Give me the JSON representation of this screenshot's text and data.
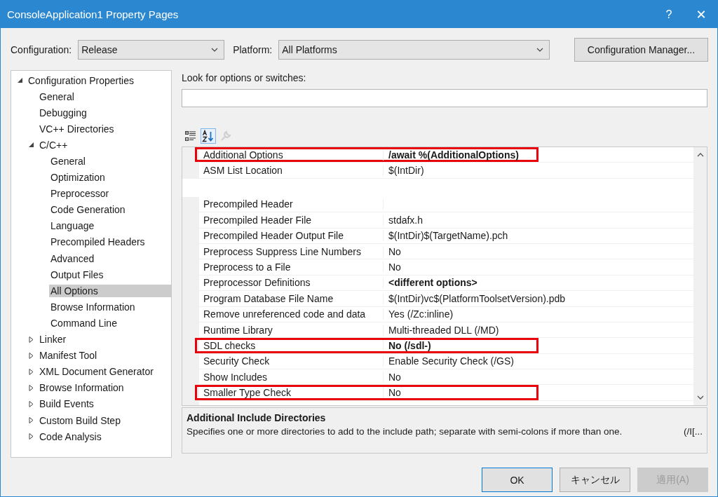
{
  "window": {
    "title": "ConsoleApplication1 Property Pages",
    "help": "?",
    "close": "✕"
  },
  "configuration": {
    "label": "Configuration:",
    "value": "Release"
  },
  "platform": {
    "label": "Platform:",
    "value": "All Platforms"
  },
  "configuration_manager": "Configuration Manager...",
  "tree": [
    {
      "label": "Configuration Properties",
      "expanded": true,
      "selected": false,
      "children": [
        {
          "label": "General",
          "selected": false
        },
        {
          "label": "Debugging",
          "selected": false
        },
        {
          "label": "VC++ Directories",
          "selected": false
        },
        {
          "label": "C/C++",
          "expanded": true,
          "selected": false,
          "children": [
            {
              "label": "General",
              "selected": false
            },
            {
              "label": "Optimization",
              "selected": false
            },
            {
              "label": "Preprocessor",
              "selected": false
            },
            {
              "label": "Code Generation",
              "selected": false
            },
            {
              "label": "Language",
              "selected": false
            },
            {
              "label": "Precompiled Headers",
              "selected": false
            },
            {
              "label": "Advanced",
              "selected": false
            },
            {
              "label": "Output Files",
              "selected": false
            },
            {
              "label": "All Options",
              "selected": true
            },
            {
              "label": "Browse Information",
              "selected": false
            },
            {
              "label": "Command Line",
              "selected": false
            }
          ]
        },
        {
          "label": "Linker",
          "expanded": false,
          "selected": false
        },
        {
          "label": "Manifest Tool",
          "expanded": false,
          "selected": false
        },
        {
          "label": "XML Document Generator",
          "expanded": false,
          "selected": false
        },
        {
          "label": "Browse Information",
          "expanded": false,
          "selected": false
        },
        {
          "label": "Build Events",
          "expanded": false,
          "selected": false
        },
        {
          "label": "Custom Build Step",
          "expanded": false,
          "selected": false
        },
        {
          "label": "Code Analysis",
          "expanded": false,
          "selected": false
        }
      ]
    }
  ],
  "search": {
    "label": "Look for options or switches:"
  },
  "toolbar": [
    {
      "kind": "categorized",
      "selected": false,
      "disabled": false
    },
    {
      "kind": "alphabetical",
      "selected": true,
      "disabled": false
    },
    {
      "kind": "property-pages",
      "selected": false,
      "disabled": true
    }
  ],
  "properties": [
    {
      "kind": "row",
      "name": "Additional Options",
      "value": "/await %(AdditionalOptions)",
      "bold": true,
      "highlighted": true
    },
    {
      "kind": "row",
      "name": "ASM List Location",
      "value": "$(IntDir)",
      "bold": false,
      "highlighted": false
    },
    {
      "kind": "covered"
    },
    {
      "kind": "row",
      "name": "Precompiled Header",
      "highlighted": false
    },
    {
      "kind": "row",
      "name": "Precompiled Header File",
      "value": "stdafx.h",
      "bold": false,
      "highlighted": false
    },
    {
      "kind": "row",
      "name": "Precompiled Header Output File",
      "value": "$(IntDir)$(TargetName).pch",
      "bold": false,
      "highlighted": false
    },
    {
      "kind": "row",
      "name": "Preprocess Suppress Line Numbers",
      "value": "No",
      "bold": false,
      "highlighted": false
    },
    {
      "kind": "row",
      "name": "Preprocess to a File",
      "value": "No",
      "bold": false,
      "highlighted": false
    },
    {
      "kind": "row",
      "name": "Preprocessor Definitions",
      "value": "<different options>",
      "bold": true,
      "highlighted": false
    },
    {
      "kind": "row",
      "name": "Program Database File Name",
      "value": "$(IntDir)vc$(PlatformToolsetVersion).pdb",
      "bold": false,
      "highlighted": false
    },
    {
      "kind": "row",
      "name": "Remove unreferenced code and data",
      "value": "Yes (/Zc:inline)",
      "bold": false,
      "highlighted": false
    },
    {
      "kind": "row",
      "name": "Runtime Library",
      "value": "Multi-threaded DLL (/MD)",
      "bold": false,
      "highlighted": false
    },
    {
      "kind": "row",
      "name": "SDL checks",
      "value": "No (/sdl-)",
      "bold": true,
      "highlighted": true
    },
    {
      "kind": "row",
      "name": "Security Check",
      "value": "Enable Security Check (/GS)",
      "bold": false,
      "highlighted": false
    },
    {
      "kind": "row",
      "name": "Show Includes",
      "value": "No",
      "bold": false,
      "highlighted": false
    },
    {
      "kind": "row",
      "name": "Smaller Type Check",
      "value": "No",
      "bold": false,
      "highlighted": true
    }
  ],
  "description": {
    "title": "Additional Include Directories",
    "text": "Specifies one or more directories to add to the include path; separate with semi-colons if more than one.",
    "switch": "(/I[..."
  },
  "buttons": [
    {
      "label": "OK",
      "default": true,
      "disabled": false
    },
    {
      "label": "キャンセル",
      "default": false,
      "disabled": false
    },
    {
      "label": "適用(A)",
      "default": false,
      "disabled": true
    }
  ]
}
